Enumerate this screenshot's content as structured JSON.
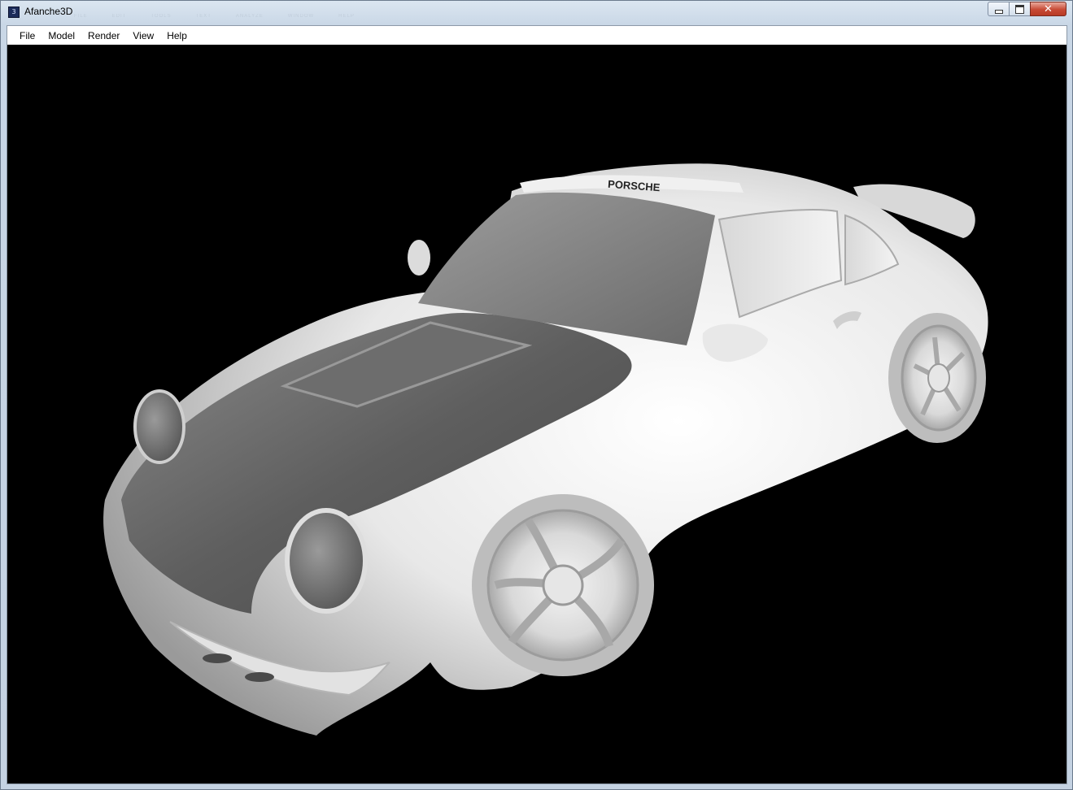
{
  "window": {
    "title": "Afanche3D",
    "icon": "app-logo-icon",
    "ghost_menu": [
      "FILE",
      "EDIT",
      "TOOLS",
      "TEXT",
      "ANALYZE",
      "WINDOW",
      "HELP"
    ],
    "caption_buttons": {
      "minimize": "minimize-icon",
      "maximize": "maximize-icon",
      "close": "✕"
    }
  },
  "menubar": {
    "items": [
      "File",
      "Model",
      "Render",
      "View",
      "Help"
    ]
  },
  "viewport": {
    "background": "#000000",
    "model": "3D sports car mesh (white shaded)",
    "roof_text": "PORSCHE"
  },
  "colors": {
    "viewport_bg": "#000000",
    "model_light": "#f2f2f2",
    "model_dark": "#5a5a5a",
    "close_red": "#c74a35"
  }
}
